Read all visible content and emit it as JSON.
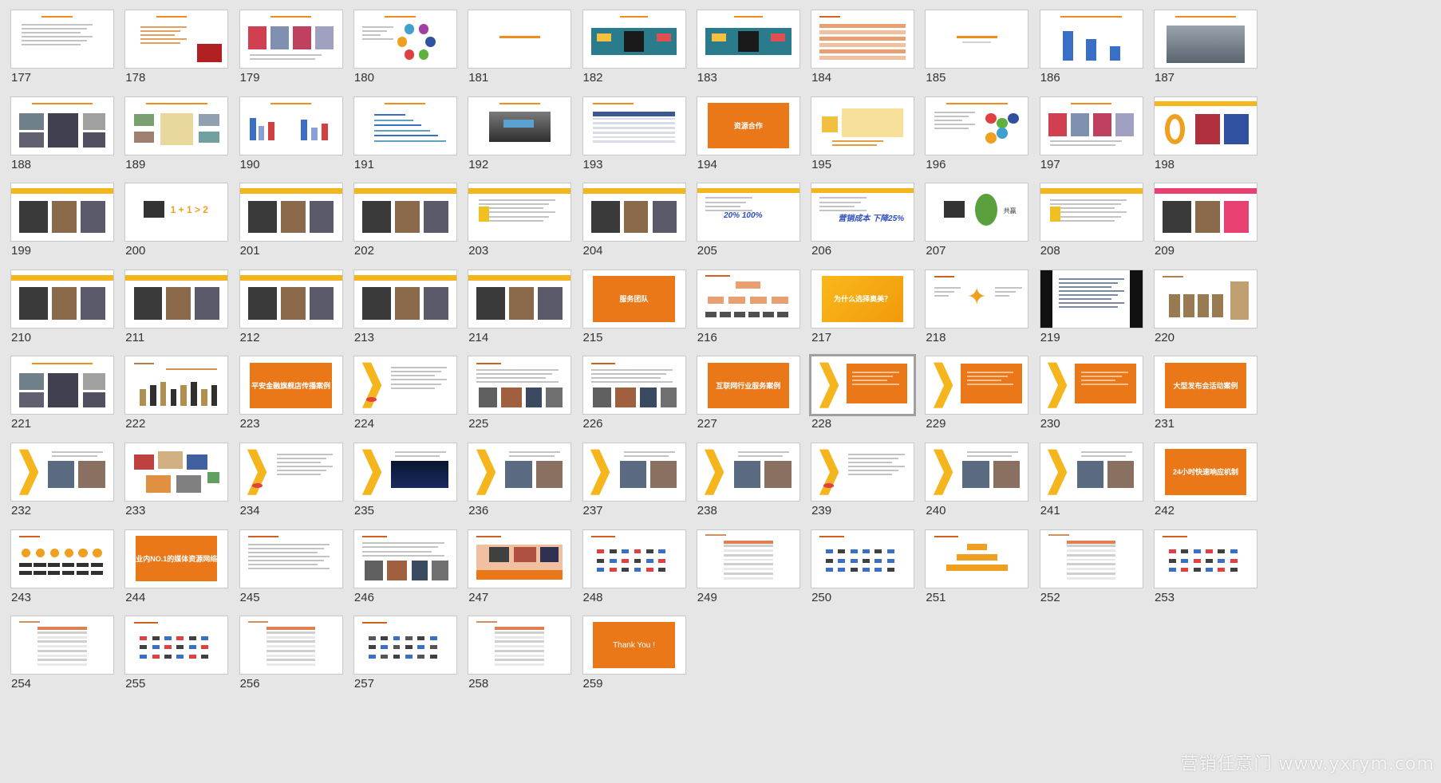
{
  "slides": [
    {
      "num": "177",
      "kind": "text",
      "accent": "#f08c1e"
    },
    {
      "num": "178",
      "kind": "text-logo",
      "accent": "#f08c1e"
    },
    {
      "num": "179",
      "kind": "photos-row",
      "accent": "#f08c1e"
    },
    {
      "num": "180",
      "kind": "circle-diagram",
      "accent": "#f08c1e"
    },
    {
      "num": "181",
      "kind": "center-title",
      "accent": "#f08c1e"
    },
    {
      "num": "182",
      "kind": "teal-diagram",
      "accent": "#2a7c8c"
    },
    {
      "num": "183",
      "kind": "teal-diagram",
      "accent": "#2a7c8c"
    },
    {
      "num": "184",
      "kind": "orange-table",
      "accent": "#e8a070"
    },
    {
      "num": "185",
      "kind": "center-title",
      "accent": "#f08c1e"
    },
    {
      "num": "186",
      "kind": "bar-chart",
      "accent": "#3a6fc8"
    },
    {
      "num": "187",
      "kind": "photo-street",
      "accent": "#888888"
    },
    {
      "num": "188",
      "kind": "photos-grid",
      "accent": "#f08c1e"
    },
    {
      "num": "189",
      "kind": "map-photos",
      "accent": "#f08c1e"
    },
    {
      "num": "190",
      "kind": "charts-pair",
      "accent": "#3a6fc8"
    },
    {
      "num": "191",
      "kind": "chart-lines",
      "accent": "#3a6fc8"
    },
    {
      "num": "192",
      "kind": "photo-center",
      "accent": "#555555"
    },
    {
      "num": "193",
      "kind": "table",
      "accent": "#3a5a90"
    },
    {
      "num": "194",
      "kind": "orange-block",
      "accent": "#ea7718",
      "label": "资源合作"
    },
    {
      "num": "195",
      "kind": "world-map",
      "accent": "#f2c040"
    },
    {
      "num": "196",
      "kind": "bubbles",
      "accent": "#f08c1e"
    },
    {
      "num": "197",
      "kind": "photos-row",
      "accent": "#f08c1e"
    },
    {
      "num": "198",
      "kind": "donut-photo",
      "accent": "#f0a020"
    },
    {
      "num": "199",
      "kind": "yellow-banner-photo",
      "accent": "#f5b51c"
    },
    {
      "num": "200",
      "kind": "formula",
      "accent": "#f0a020",
      "label": "1 + 1 > 2"
    },
    {
      "num": "201",
      "kind": "yellow-banner-photo",
      "accent": "#f5b51c"
    },
    {
      "num": "202",
      "kind": "yellow-banner-photo",
      "accent": "#f5b51c"
    },
    {
      "num": "203",
      "kind": "yellow-banner-text",
      "accent": "#f5b51c"
    },
    {
      "num": "204",
      "kind": "yellow-banner-photo",
      "accent": "#f5b51c"
    },
    {
      "num": "205",
      "kind": "yellow-banner-stat",
      "accent": "#f5b51c",
      "label": "20% 100%"
    },
    {
      "num": "206",
      "kind": "yellow-banner-stat",
      "accent": "#f5b51c",
      "label": "营销成本 下降25%"
    },
    {
      "num": "207",
      "kind": "tree",
      "accent": "#5aa03c",
      "label": "共赢"
    },
    {
      "num": "208",
      "kind": "yellow-banner-text",
      "accent": "#f5b51c"
    },
    {
      "num": "209",
      "kind": "yellow-banner-photo",
      "accent": "#e84070"
    },
    {
      "num": "210",
      "kind": "yellow-banner-photo",
      "accent": "#f5b51c"
    },
    {
      "num": "211",
      "kind": "yellow-banner-photo",
      "accent": "#f5b51c"
    },
    {
      "num": "212",
      "kind": "yellow-banner-photo",
      "accent": "#f5b51c"
    },
    {
      "num": "213",
      "kind": "yellow-banner-photo",
      "accent": "#f5b51c"
    },
    {
      "num": "214",
      "kind": "yellow-banner-photo",
      "accent": "#f5b51c"
    },
    {
      "num": "215",
      "kind": "orange-block",
      "accent": "#ea7718",
      "label": "服务团队"
    },
    {
      "num": "216",
      "kind": "org-chart",
      "accent": "#e8a070"
    },
    {
      "num": "217",
      "kind": "orange-gradient",
      "accent": "#f7a413",
      "label": "为什么选择奥美？"
    },
    {
      "num": "218",
      "kind": "star-diagram",
      "accent": "#f0a020"
    },
    {
      "num": "219",
      "kind": "black-sides",
      "accent": "#111111"
    },
    {
      "num": "220",
      "kind": "frames",
      "accent": "#9a7a50"
    },
    {
      "num": "221",
      "kind": "photos-grid",
      "accent": "#7050a0"
    },
    {
      "num": "222",
      "kind": "trophies",
      "accent": "#b09050"
    },
    {
      "num": "223",
      "kind": "orange-block",
      "accent": "#ea7718",
      "label": "平安金融旗舰店传播案例"
    },
    {
      "num": "224",
      "kind": "chevron-text",
      "accent": "#f5b51c"
    },
    {
      "num": "225",
      "kind": "text-photos",
      "accent": "#f08c1e"
    },
    {
      "num": "226",
      "kind": "text-photos",
      "accent": "#f08c1e"
    },
    {
      "num": "227",
      "kind": "orange-block",
      "accent": "#ea7718",
      "label": "互联网行业服务案例"
    },
    {
      "num": "228",
      "kind": "chevron-orange",
      "accent": "#ea7718",
      "selected": true
    },
    {
      "num": "229",
      "kind": "chevron-orange",
      "accent": "#ea7718"
    },
    {
      "num": "230",
      "kind": "chevron-orange",
      "accent": "#ea7718"
    },
    {
      "num": "231",
      "kind": "orange-block",
      "accent": "#ea7718",
      "label": "大型发布会活动案例"
    },
    {
      "num": "232",
      "kind": "chevron-photo",
      "accent": "#f5b51c"
    },
    {
      "num": "233",
      "kind": "photos-collage",
      "accent": "#f08c1e"
    },
    {
      "num": "234",
      "kind": "chevron-text",
      "accent": "#f5b51c"
    },
    {
      "num": "235",
      "kind": "chevron-photo-dark",
      "accent": "#f5b51c"
    },
    {
      "num": "236",
      "kind": "chevron-photo",
      "accent": "#f5b51c"
    },
    {
      "num": "237",
      "kind": "chevron-photo",
      "accent": "#f5b51c"
    },
    {
      "num": "238",
      "kind": "chevron-photo",
      "accent": "#f5b51c"
    },
    {
      "num": "239",
      "kind": "chevron-text",
      "accent": "#f5b51c"
    },
    {
      "num": "240",
      "kind": "chevron-photo",
      "accent": "#f5b51c"
    },
    {
      "num": "241",
      "kind": "chevron-photo",
      "accent": "#f5b51c"
    },
    {
      "num": "242",
      "kind": "orange-block",
      "accent": "#ea7718",
      "label": "24小时快速响应机制"
    },
    {
      "num": "243",
      "kind": "icon-row",
      "accent": "#f0a020"
    },
    {
      "num": "244",
      "kind": "orange-block",
      "accent": "#ea7718",
      "label": "业内NO.1的媒体资源网络"
    },
    {
      "num": "245",
      "kind": "text-lines",
      "accent": "#f08c1e"
    },
    {
      "num": "246",
      "kind": "text-photos",
      "accent": "#f08c1e"
    },
    {
      "num": "247",
      "kind": "collage-orange",
      "accent": "#ea7718"
    },
    {
      "num": "248",
      "kind": "logo-grid",
      "accent": "#e04040"
    },
    {
      "num": "249",
      "kind": "table-center",
      "accent": "#e08050"
    },
    {
      "num": "250",
      "kind": "logo-grid",
      "accent": "#3a6fc8"
    },
    {
      "num": "251",
      "kind": "pyramid",
      "accent": "#f0a020"
    },
    {
      "num": "252",
      "kind": "table-center",
      "accent": "#e08050"
    },
    {
      "num": "253",
      "kind": "logo-grid",
      "accent": "#e04040"
    },
    {
      "num": "254",
      "kind": "table-center",
      "accent": "#e08050"
    },
    {
      "num": "255",
      "kind": "logo-grid",
      "accent": "#e04040"
    },
    {
      "num": "256",
      "kind": "table-center",
      "accent": "#e08050"
    },
    {
      "num": "257",
      "kind": "logo-grid",
      "accent": "#555555"
    },
    {
      "num": "258",
      "kind": "table-center",
      "accent": "#e08050"
    },
    {
      "num": "259",
      "kind": "orange-block",
      "accent": "#ea7718",
      "label": "Thank  You !"
    }
  ],
  "watermark": "营销任意门 www.yxrym.com"
}
